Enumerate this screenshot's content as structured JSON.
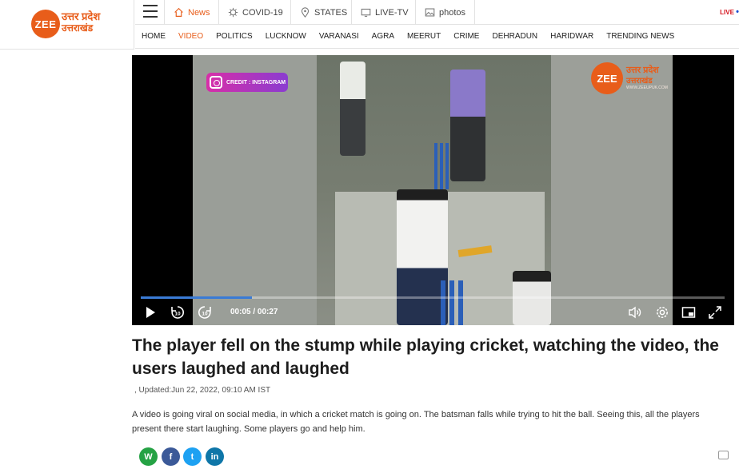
{
  "logo": {
    "mark": "ZEE",
    "line1": "उत्तर प्रदेश",
    "line2": "उत्तराखंड"
  },
  "topnav": [
    {
      "label": "News",
      "icon": "home-icon",
      "active": true
    },
    {
      "label": "COVID-19",
      "icon": "virus-icon",
      "active": false
    },
    {
      "label": "STATES",
      "icon": "location-pin-icon",
      "active": false
    },
    {
      "label": "LIVE-TV",
      "icon": "tv-icon",
      "active": false
    },
    {
      "label": "photos",
      "icon": "image-icon",
      "active": false
    }
  ],
  "live_label": "LIVE",
  "mainnav": [
    "HOME",
    "VIDEO",
    "POLITICS",
    "LUCKNOW",
    "VARANASI",
    "AGRA",
    "MEERUT",
    "CRIME",
    "DEHRADUN",
    "HARIDWAR",
    "TRENDING NEWS"
  ],
  "mainnav_active": "VIDEO",
  "video": {
    "credit_label": "CREDIT : INSTAGRAM",
    "watermark_mark": "ZEE",
    "watermark_line1": "उत्तर प्रदेश",
    "watermark_line2": "उत्तराखंड",
    "watermark_url": "WWW.ZEEUPUK.COM",
    "time": "00:05 / 00:27",
    "progress": 0.19,
    "rewind_seconds": "10",
    "forward_seconds": "10"
  },
  "article": {
    "headline": "The player fell on the stump while playing cricket, watching the video, the users laughed and laughed",
    "updated": ", Updated:Jun 22, 2022, 09:10 AM IST",
    "description": "A video is going viral on social media, in which a cricket match is going on. The batsman falls while trying to hit the ball. Seeing this, all the players present there start laughing. Some players go and help him."
  },
  "share": [
    {
      "name": "whatsapp",
      "glyph": "W",
      "color": "#25a244"
    },
    {
      "name": "facebook",
      "glyph": "f",
      "color": "#3b5998"
    },
    {
      "name": "twitter",
      "glyph": "t",
      "color": "#1da1f2"
    },
    {
      "name": "linkedin",
      "glyph": "in",
      "color": "#0e76a8"
    }
  ],
  "colors": {
    "accent": "#e85d1a",
    "progress": "#3a7bd5"
  }
}
